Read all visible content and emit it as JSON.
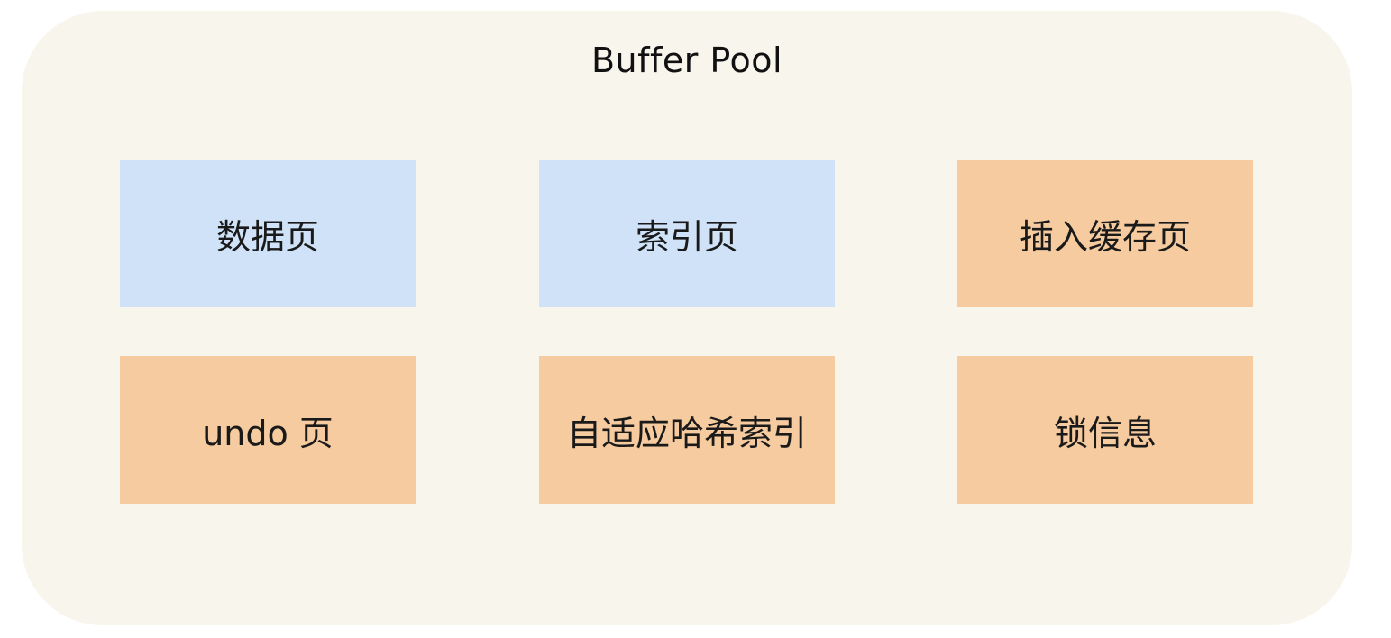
{
  "pool": {
    "title": "Buffer Pool",
    "background": "#f8f5ec"
  },
  "colors": {
    "blue": "#cfe2f8",
    "orange": "#f5cb9f"
  },
  "boxes": [
    {
      "label": "数据页",
      "color": "blue"
    },
    {
      "label": "索引页",
      "color": "blue"
    },
    {
      "label": "插入缓存页",
      "color": "orange"
    },
    {
      "label": "undo 页",
      "color": "orange"
    },
    {
      "label": "自适应哈希索引",
      "color": "orange"
    },
    {
      "label": "锁信息",
      "color": "orange"
    }
  ]
}
